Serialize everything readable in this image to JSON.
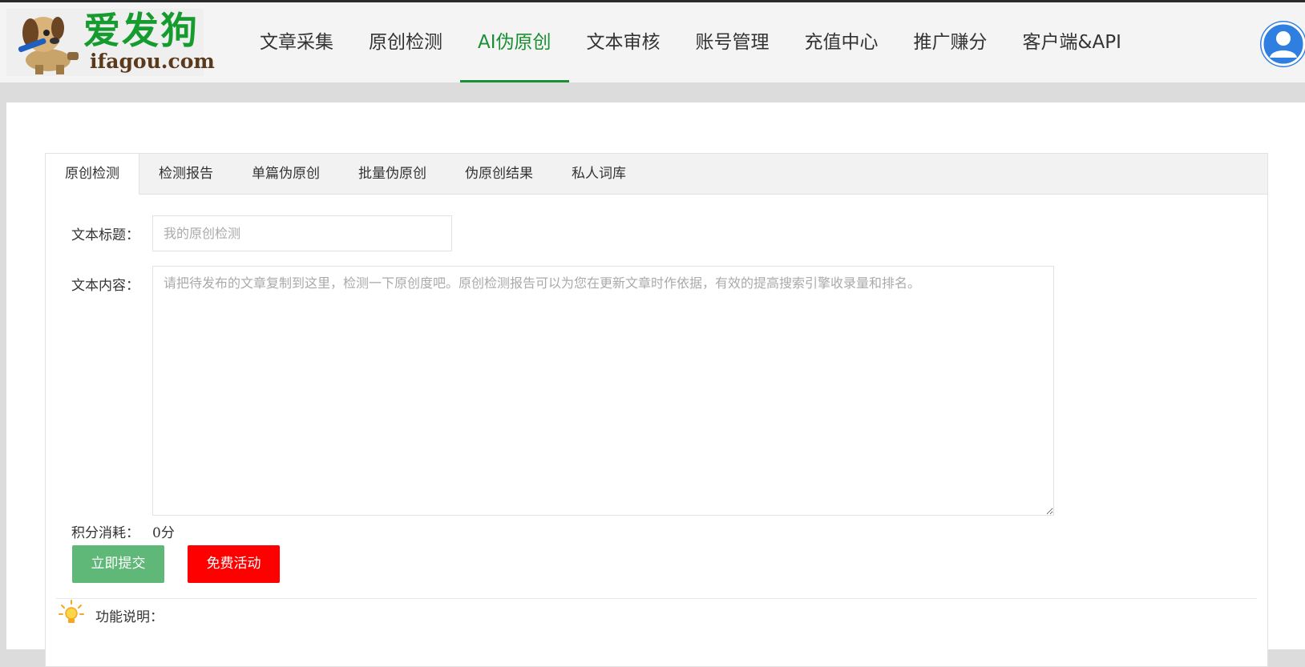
{
  "logo": {
    "cn": "爱发狗",
    "en": "ifagou.com"
  },
  "nav": {
    "items": [
      {
        "label": "文章采集"
      },
      {
        "label": "原创检测"
      },
      {
        "label": "AI伪原创",
        "active": true
      },
      {
        "label": "文本审核"
      },
      {
        "label": "账号管理"
      },
      {
        "label": "充值中心"
      },
      {
        "label": "推广赚分"
      },
      {
        "label": "客户端&API"
      }
    ],
    "active_color": "#1a8f33"
  },
  "tabs": [
    {
      "label": "原创检测",
      "active": true
    },
    {
      "label": "检测报告"
    },
    {
      "label": "单篇伪原创"
    },
    {
      "label": "批量伪原创"
    },
    {
      "label": "伪原创结果"
    },
    {
      "label": "私人词库"
    }
  ],
  "form": {
    "title_label": "文本标题：",
    "title_placeholder": "我的原创检测",
    "title_value": "",
    "content_label": "文本内容：",
    "content_placeholder": "请把待发布的文章复制到这里，检测一下原创度吧。原创检测报告可以为您在更新文章时作依据，有效的提高搜索引擎收录量和排名。",
    "content_value": "",
    "cost_label": "积分消耗：",
    "cost_value": "0分"
  },
  "buttons": {
    "submit_label": "立即提交",
    "submit_color": "#5fb878",
    "free_label": "免费活动",
    "free_color": "#ff0000"
  },
  "info": {
    "heading": "功能说明："
  },
  "icons": {
    "avatar": "user-avatar-icon",
    "bulb": "lightbulb-icon",
    "logo": "dog-mascot-icon"
  }
}
